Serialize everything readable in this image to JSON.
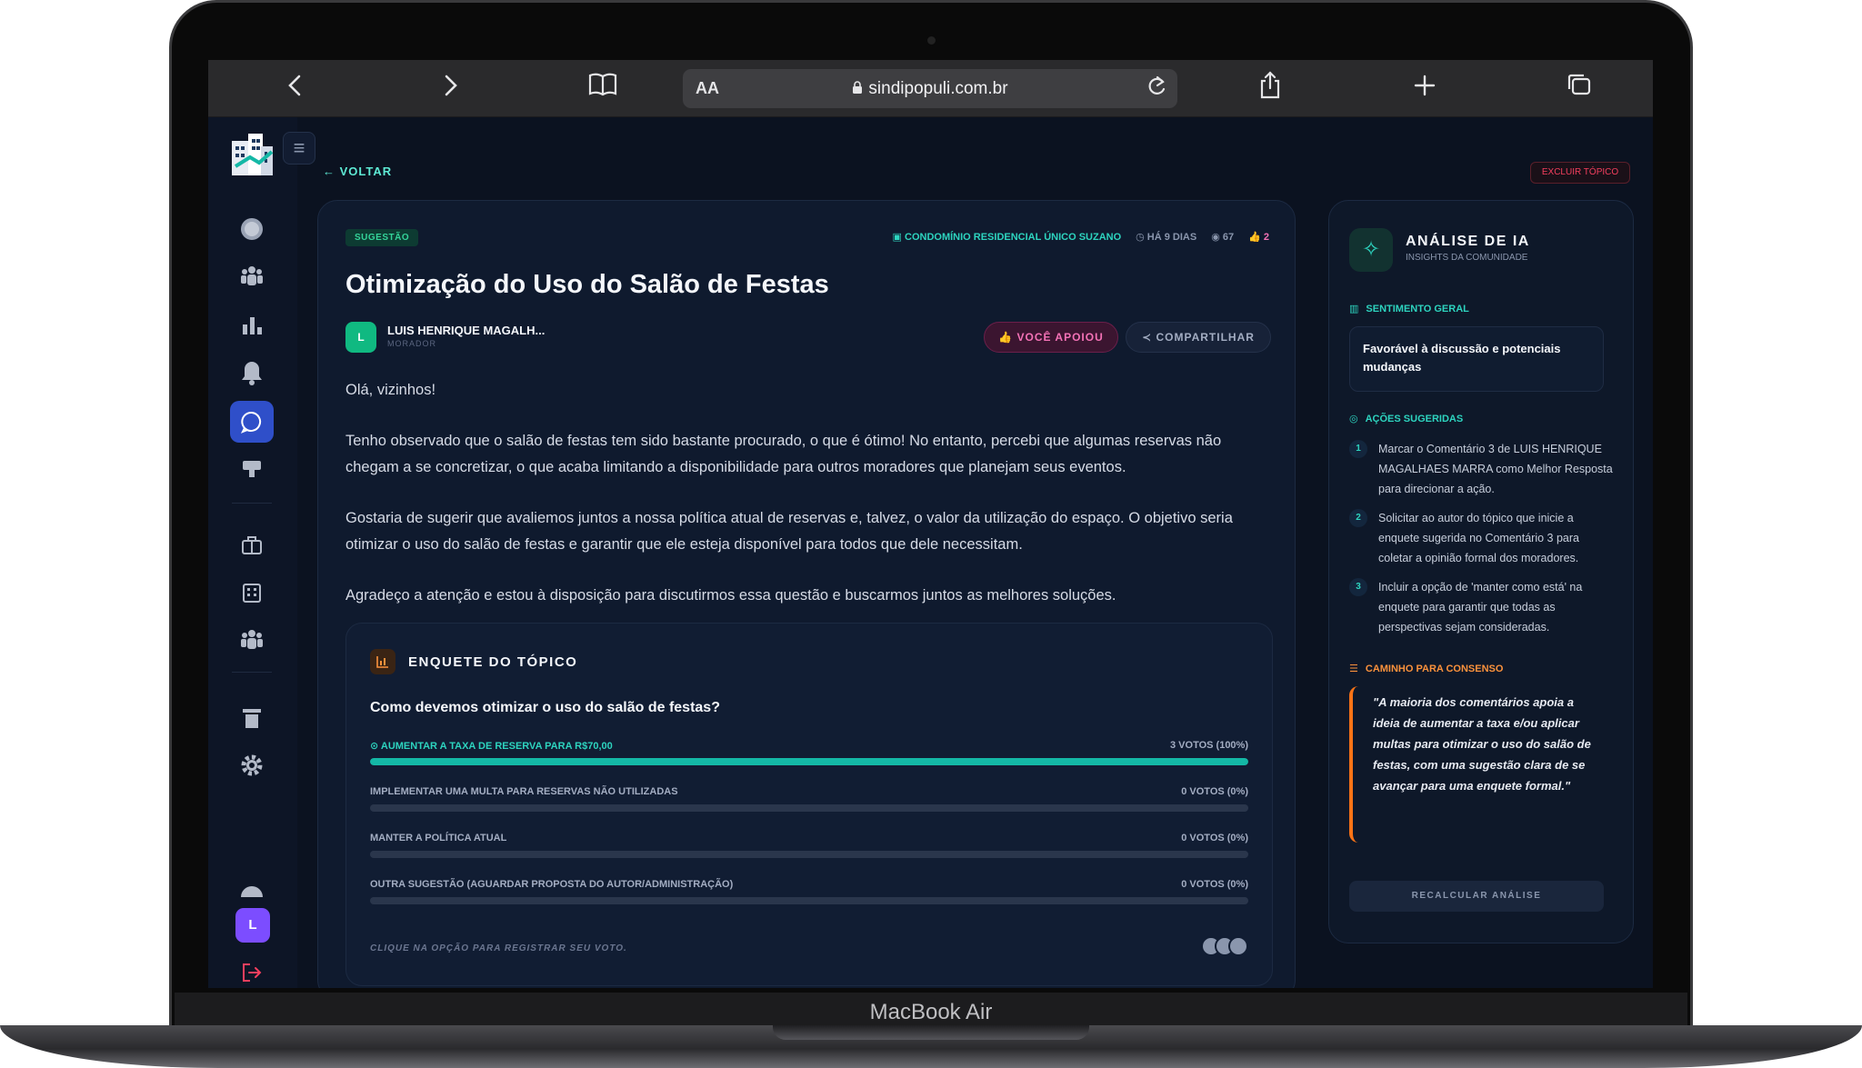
{
  "device": {
    "label": "MacBook Air"
  },
  "browser": {
    "aa_label": "AA",
    "url": "sindipopuli.com.br",
    "icons": [
      "chevron-left-icon",
      "chevron-right-icon",
      "book-icon",
      "lock-icon",
      "reload-icon",
      "share-icon",
      "plus-icon",
      "tabs-icon"
    ]
  },
  "sidebar": {
    "avatar_initial": "L",
    "icons": [
      "dashboard-icon",
      "people-icon",
      "chart-icon",
      "bell-icon",
      "chat-icon",
      "megaphone-icon",
      "briefcase-icon",
      "building-icon",
      "group-icon",
      "trash-icon",
      "gear-icon",
      "user-icon",
      "logout-icon"
    ],
    "active": "chat-icon"
  },
  "topbar": {
    "back_label": "← VOLTAR",
    "delete_label": "EXCLUIR TÓPICO"
  },
  "topic": {
    "tag": "SUGESTÃO",
    "condo": "CONDOMÍNIO RESIDENCIAL ÚNICO SUZANO",
    "time": "HÁ 9 DIAS",
    "views": "67",
    "likes": "2",
    "title": "Otimização do Uso do Salão de Festas",
    "author_initial": "L",
    "author_name": "LUIS HENRIQUE MAGALH...",
    "author_role": "MORADOR",
    "support_label": "VOCÊ APOIOU",
    "share_label": "COMPARTILHAR",
    "paragraphs": [
      "Olá, vizinhos!",
      "Tenho observado que o salão de festas tem sido bastante procurado, o que é ótimo! No entanto, percebi que algumas reservas não chegam a se concretizar, o que acaba limitando a disponibilidade para outros moradores que planejam seus eventos.",
      "Gostaria de sugerir que avaliemos juntos a nossa política atual de reservas e, talvez, o valor da utilização do espaço. O objetivo seria otimizar o uso do salão de festas e garantir que ele esteja disponível para todos que dele necessitam.",
      "Agradeço a atenção e estou à disposição para discutirmos essa questão e buscarmos juntos as melhores soluções."
    ]
  },
  "poll": {
    "title": "ENQUETE DO TÓPICO",
    "question": "Como devemos otimizar o uso do salão de festas?",
    "options": [
      {
        "label": "AUMENTAR A TAXA DE RESERVA PARA R$70,00",
        "votes": "3 VOTOS (100%)",
        "percent": 100,
        "selected": true
      },
      {
        "label": "IMPLEMENTAR UMA MULTA PARA RESERVAS NÃO UTILIZADAS",
        "votes": "0 VOTOS (0%)",
        "percent": 0,
        "selected": false
      },
      {
        "label": "MANTER A POLÍTICA ATUAL",
        "votes": "0 VOTOS (0%)",
        "percent": 0,
        "selected": false
      },
      {
        "label": "OUTRA SUGESTÃO (AGUARDAR PROPOSTA DO AUTOR/ADMINISTRAÇÃO)",
        "votes": "0 VOTOS (0%)",
        "percent": 0,
        "selected": false
      }
    ],
    "hint": "CLIQUE NA OPÇÃO PARA REGISTRAR SEU VOTO."
  },
  "ai": {
    "title": "ANÁLISE DE IA",
    "subtitle": "INSIGHTS DA COMUNIDADE",
    "sentiment_heading": "SENTIMENTO GERAL",
    "sentiment": "Favorável à discussão e potenciais mudanças",
    "actions_heading": "AÇÕES SUGERIDAS",
    "actions": [
      {
        "num": "1",
        "text": "Marcar o Comentário 3 de LUIS HENRIQUE MAGALHAES MARRA como Melhor Resposta para direcionar a ação."
      },
      {
        "num": "2",
        "text": "Solicitar ao autor do tópico que inicie a enquete sugerida no Comentário 3 para coletar a opinião formal dos moradores."
      },
      {
        "num": "3",
        "text": "Incluir a opção de 'manter como está' na enquete para garantir que todas as perspectivas sejam consideradas."
      }
    ],
    "consensus_heading": "CAMINHO PARA CONSENSO",
    "consensus": "\"A maioria dos comentários apoia a ideia de aumentar a taxa e/ou aplicar multas para otimizar o uso do salão de festas, com uma sugestão clara de se avançar para uma enquete formal.\"",
    "recalc_label": "RECALCULAR ANÁLISE"
  },
  "colors": {
    "accent": "#14b8a6",
    "active_nav": "#2f4fc9",
    "support": "#f472b6",
    "consensus": "#f97316"
  }
}
